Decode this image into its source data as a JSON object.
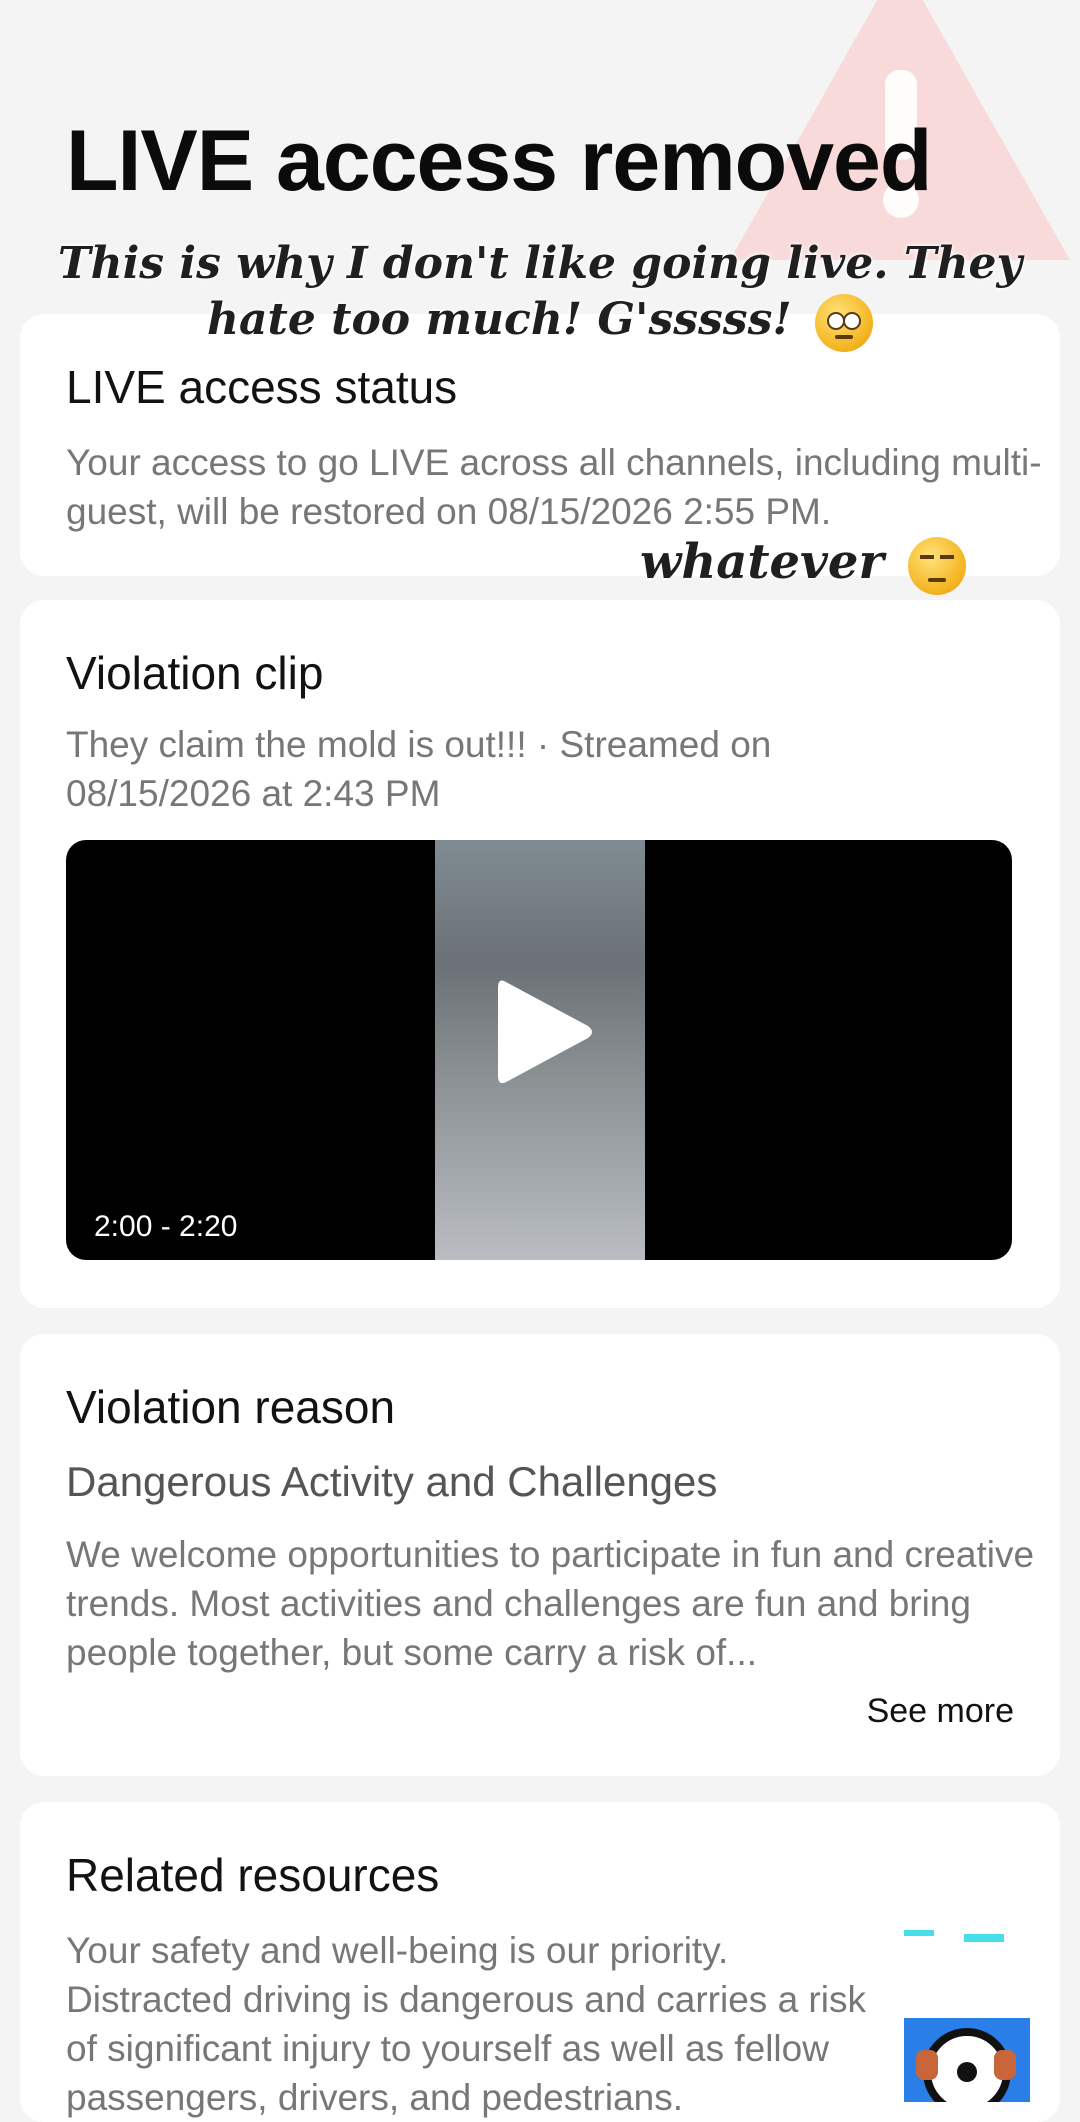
{
  "page": {
    "title": "LIVE access removed"
  },
  "overlay": {
    "caption": "This is why I don't like going live. They hate too much! G'sssss!",
    "caption_emoji": "eye-roll-emoji",
    "note": "whatever",
    "note_emoji": "unamused-emoji"
  },
  "status_card": {
    "title": "LIVE access status",
    "body": "Your access to go LIVE across all channels, including multi-guest, will be restored on 08/15/2026 2:55 PM."
  },
  "clip_card": {
    "title": "Violation clip",
    "meta": "They claim the mold is out!!! · Streamed on 08/15/2026 at 2:43 PM",
    "time_range": "2:00 - 2:20",
    "play_icon": "play-icon"
  },
  "reason_card": {
    "title": "Violation reason",
    "category": "Dangerous Activity and Challenges",
    "description": "We welcome opportunities to participate in fun and creative trends. Most activities and challenges are fun and bring people together, but some carry a risk of...",
    "see_more": "See more"
  },
  "resources_card": {
    "title": "Related resources",
    "body": "Your safety and well-being is our priority. Distracted driving is dangerous and carries a risk of significant injury to yourself as well as fellow passengers, drivers, and pedestrians.",
    "thumbnail_icon": "steering-wheel-icon"
  },
  "colors": {
    "background": "#f4f4f4",
    "card": "#ffffff",
    "warning_accent": "#f8d4d4"
  }
}
